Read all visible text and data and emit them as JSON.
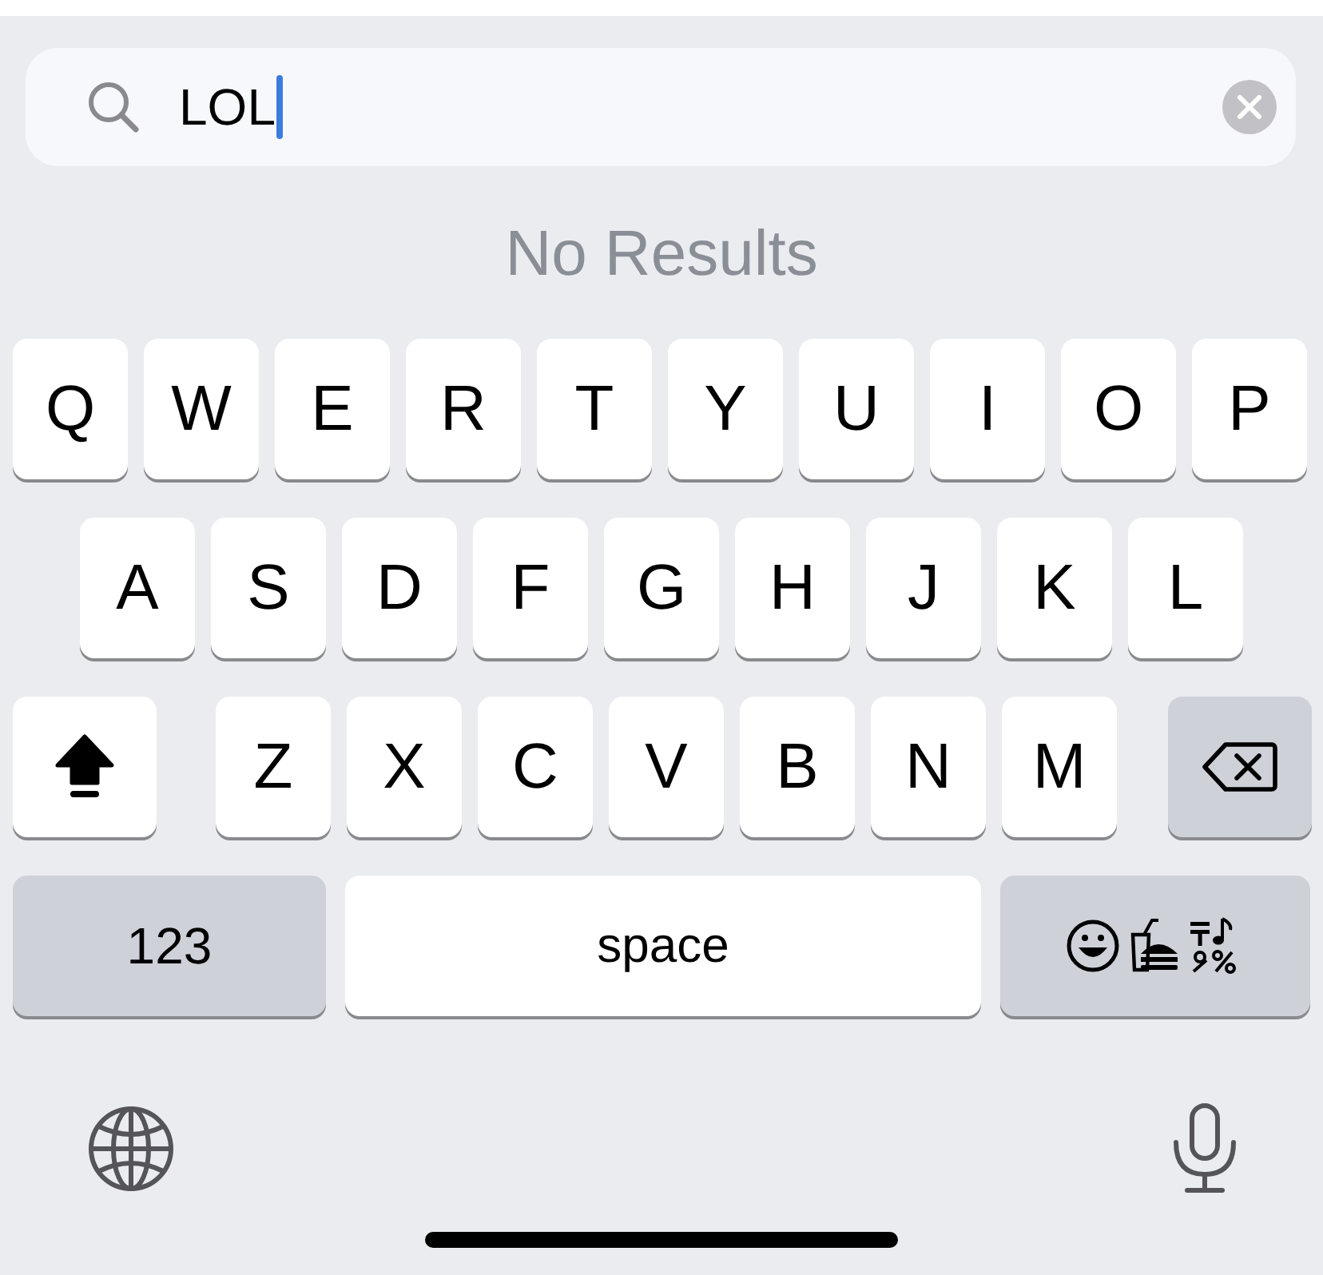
{
  "search": {
    "value": "LOL"
  },
  "message": "No Results",
  "keyboard": {
    "shift_on": true,
    "rows": [
      {
        "keys": [
          {
            "kind": "letter",
            "label": "Q"
          },
          {
            "kind": "letter",
            "label": "W"
          },
          {
            "kind": "letter",
            "label": "E"
          },
          {
            "kind": "letter",
            "label": "R"
          },
          {
            "kind": "letter",
            "label": "T"
          },
          {
            "kind": "letter",
            "label": "Y"
          },
          {
            "kind": "letter",
            "label": "U"
          },
          {
            "kind": "letter",
            "label": "I"
          },
          {
            "kind": "letter",
            "label": "O"
          },
          {
            "kind": "letter",
            "label": "P"
          }
        ]
      },
      {
        "keys": [
          {
            "kind": "letter",
            "label": "A"
          },
          {
            "kind": "letter",
            "label": "S"
          },
          {
            "kind": "letter",
            "label": "D"
          },
          {
            "kind": "letter",
            "label": "F"
          },
          {
            "kind": "letter",
            "label": "G"
          },
          {
            "kind": "letter",
            "label": "H"
          },
          {
            "kind": "letter",
            "label": "J"
          },
          {
            "kind": "letter",
            "label": "K"
          },
          {
            "kind": "letter",
            "label": "L"
          }
        ]
      },
      {
        "keys": [
          {
            "kind": "shift"
          },
          {
            "kind": "letter",
            "label": "Z"
          },
          {
            "kind": "letter",
            "label": "X"
          },
          {
            "kind": "letter",
            "label": "C"
          },
          {
            "kind": "letter",
            "label": "V"
          },
          {
            "kind": "letter",
            "label": "B"
          },
          {
            "kind": "letter",
            "label": "N"
          },
          {
            "kind": "letter",
            "label": "M"
          },
          {
            "kind": "delete"
          }
        ]
      },
      {
        "keys": [
          {
            "kind": "numbers",
            "label": "123"
          },
          {
            "kind": "space",
            "label": "space"
          },
          {
            "kind": "emoji"
          }
        ]
      }
    ]
  }
}
